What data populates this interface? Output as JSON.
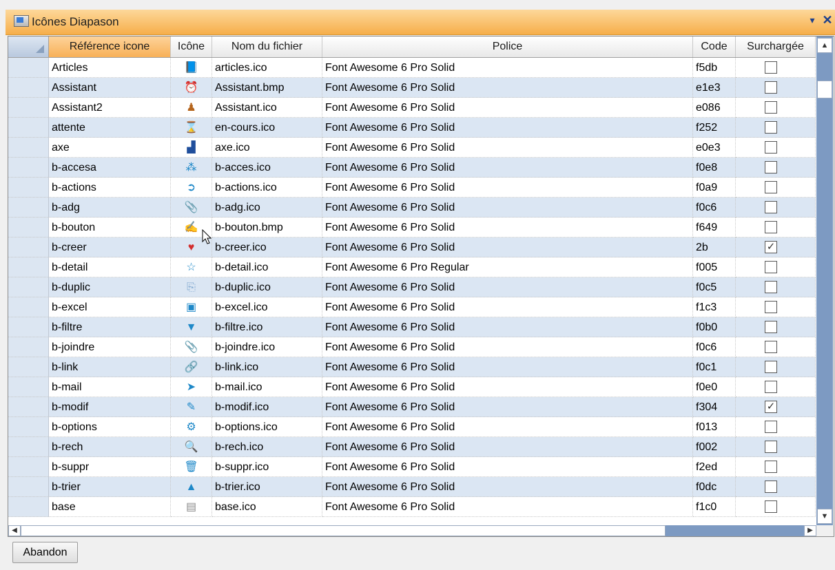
{
  "window": {
    "title": "Icônes Diapason",
    "dropdown_glyph": "▾",
    "close_glyph": "✕"
  },
  "columns": [
    {
      "key": "ref",
      "label": "Référence icone"
    },
    {
      "key": "icon",
      "label": "Icône"
    },
    {
      "key": "file",
      "label": "Nom du fichier"
    },
    {
      "key": "font",
      "label": "Police"
    },
    {
      "key": "code",
      "label": "Code"
    },
    {
      "key": "over",
      "label": "Surchargée"
    }
  ],
  "rows": [
    {
      "ref": "Articles",
      "icon": "📘",
      "icon_name": "book-icon",
      "icon_color": "#c0392b",
      "file": "articles.ico",
      "font": "Font Awesome 6 Pro Solid",
      "code": "f5db",
      "over": false
    },
    {
      "ref": "Assistant",
      "icon": "⏰",
      "icon_name": "assistant-clock-icon",
      "icon_color": "#333333",
      "file": "Assistant.bmp",
      "font": "Font Awesome 6 Pro Solid",
      "code": "e1e3",
      "over": false
    },
    {
      "ref": "Assistant2",
      "icon": "♟",
      "icon_name": "assistant-figure-icon",
      "icon_color": "#b5651d",
      "file": "Assistant.ico",
      "font": "Font Awesome 6 Pro Solid",
      "code": "e086",
      "over": false
    },
    {
      "ref": "attente",
      "icon": "⌛",
      "icon_name": "hourglass-icon",
      "icon_color": "#8a6b4a",
      "file": "en-cours.ico",
      "font": "Font Awesome 6 Pro Solid",
      "code": "f252",
      "over": false
    },
    {
      "ref": "axe",
      "icon": "▟",
      "icon_name": "chart-icon",
      "icon_color": "#1f4e9c",
      "file": "axe.ico",
      "font": "Font Awesome 6 Pro Solid",
      "code": "e0e3",
      "over": false
    },
    {
      "ref": "b-accesa",
      "icon": "⁂",
      "icon_name": "sitemap-icon",
      "icon_color": "#1e88c8",
      "file": "b-acces.ico",
      "font": "Font Awesome 6 Pro Solid",
      "code": "f0e8",
      "over": false
    },
    {
      "ref": "b-actions",
      "icon": "➲",
      "icon_name": "circle-arrow-icon",
      "icon_color": "#1e88c8",
      "file": "b-actions.ico",
      "font": "Font Awesome 6 Pro Solid",
      "code": "f0a9",
      "over": false
    },
    {
      "ref": "b-adg",
      "icon": "📎",
      "icon_name": "paperclip-icon",
      "icon_color": "#7fa7cf",
      "file": "b-adg.ico",
      "font": "Font Awesome 6 Pro Solid",
      "code": "f0c6",
      "over": false
    },
    {
      "ref": "b-bouton",
      "icon": "✍",
      "icon_name": "signature-icon",
      "icon_color": "#333333",
      "file": "b-bouton.bmp",
      "font": "Font Awesome 6 Pro Solid",
      "code": "f649",
      "over": false
    },
    {
      "ref": "b-creer",
      "icon": "♥",
      "icon_name": "superman-icon",
      "icon_color": "#d32f2f",
      "file": "b-creer.ico",
      "font": "Font Awesome 6 Pro Solid",
      "code": "2b",
      "over": true
    },
    {
      "ref": "b-detail",
      "icon": "☆",
      "icon_name": "star-icon",
      "icon_color": "#1e88c8",
      "file": "b-detail.ico",
      "font": "Font Awesome 6 Pro Regular",
      "code": "f005",
      "over": false
    },
    {
      "ref": "b-duplic",
      "icon": "⎘",
      "icon_name": "copy-icon",
      "icon_color": "#7fa7cf",
      "file": "b-duplic.ico",
      "font": "Font Awesome 6 Pro Solid",
      "code": "f0c5",
      "over": false
    },
    {
      "ref": "b-excel",
      "icon": "▣",
      "icon_name": "excel-file-icon",
      "icon_color": "#1e88c8",
      "file": "b-excel.ico",
      "font": "Font Awesome 6 Pro Solid",
      "code": "f1c3",
      "over": false
    },
    {
      "ref": "b-filtre",
      "icon": "▼",
      "icon_name": "filter-icon",
      "icon_color": "#1e88c8",
      "file": "b-filtre.ico",
      "font": "Font Awesome 6 Pro Solid",
      "code": "f0b0",
      "over": false
    },
    {
      "ref": "b-joindre",
      "icon": "📎",
      "icon_name": "paperclip-icon",
      "icon_color": "#7fa7cf",
      "file": "b-joindre.ico",
      "font": "Font Awesome 6 Pro Solid",
      "code": "f0c6",
      "over": false
    },
    {
      "ref": "b-link",
      "icon": "🔗",
      "icon_name": "link-icon",
      "icon_color": "#7fa7cf",
      "file": "b-link.ico",
      "font": "Font Awesome 6 Pro Solid",
      "code": "f0c1",
      "over": false
    },
    {
      "ref": "b-mail",
      "icon": "➤",
      "icon_name": "paper-plane-icon",
      "icon_color": "#1e88c8",
      "file": "b-mail.ico",
      "font": "Font Awesome 6 Pro Solid",
      "code": "f0e0",
      "over": false
    },
    {
      "ref": "b-modif",
      "icon": "✎",
      "icon_name": "pencil-icon",
      "icon_color": "#1e88c8",
      "file": "b-modif.ico",
      "font": "Font Awesome 6 Pro Solid",
      "code": "f304",
      "over": true
    },
    {
      "ref": "b-options",
      "icon": "⚙",
      "icon_name": "gear-icon",
      "icon_color": "#1e88c8",
      "file": "b-options.ico",
      "font": "Font Awesome 6 Pro Solid",
      "code": "f013",
      "over": false
    },
    {
      "ref": "b-rech",
      "icon": "🔍",
      "icon_name": "search-icon",
      "icon_color": "#1e88c8",
      "file": "b-rech.ico",
      "font": "Font Awesome 6 Pro Solid",
      "code": "f002",
      "over": false
    },
    {
      "ref": "b-suppr",
      "icon": "🗑",
      "icon_name": "trash-icon",
      "icon_color": "#1e88c8",
      "file": "b-suppr.ico",
      "font": "Font Awesome 6 Pro Solid",
      "code": "f2ed",
      "over": false
    },
    {
      "ref": "b-trier",
      "icon": "▲",
      "icon_name": "sort-up-icon",
      "icon_color": "#1e88c8",
      "file": "b-trier.ico",
      "font": "Font Awesome 6 Pro Solid",
      "code": "f0dc",
      "over": false
    },
    {
      "ref": "base",
      "icon": "▤",
      "icon_name": "database-icon",
      "icon_color": "#8a8a8a",
      "file": "base.ico",
      "font": "Font Awesome 6 Pro Solid",
      "code": "f1c0",
      "over": false
    }
  ],
  "footer": {
    "cancel_label": "Abandon"
  },
  "colors": {
    "title_bar": "#f6ae4a",
    "active_header": "#f8b057",
    "alt_row": "#dbe6f3",
    "scrollbar": "#7d9ac2"
  }
}
